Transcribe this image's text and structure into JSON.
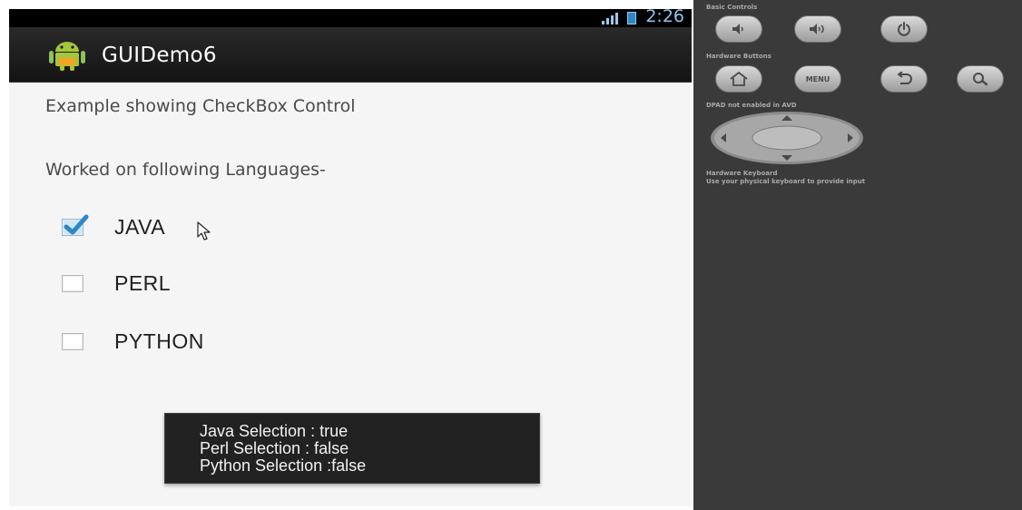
{
  "status_bar": {
    "time": "2:26",
    "signal_icon": "signal-icon",
    "battery_icon": "battery-charging-icon"
  },
  "action_bar": {
    "app_title": "GUIDemo6",
    "app_icon": "android-icon"
  },
  "content": {
    "heading": "Example showing CheckBox Control",
    "subheading": "Worked on following Languages-",
    "checkboxes": [
      {
        "label": "JAVA",
        "checked": true
      },
      {
        "label": "PERL",
        "checked": false
      },
      {
        "label": "PYTHON",
        "checked": false
      }
    ]
  },
  "toast": {
    "lines": [
      "Java Selection : true",
      "Perl Selection : false",
      "Python Selection :false"
    ]
  },
  "emulator_panel": {
    "basic_controls_label": "Basic Controls",
    "hardware_buttons_label": "Hardware Buttons",
    "menu_button_label": "MENU",
    "dpad_label": "DPAD not enabled in AVD",
    "keyboard_label_line1": "Hardware Keyboard",
    "keyboard_label_line2": "Use your physical keyboard to provide input"
  },
  "colors": {
    "action_bar": "#1e1e1e",
    "checkbox_check": "#2f86c9",
    "panel_background": "#3a3a3a",
    "toast_background": "#222222"
  }
}
